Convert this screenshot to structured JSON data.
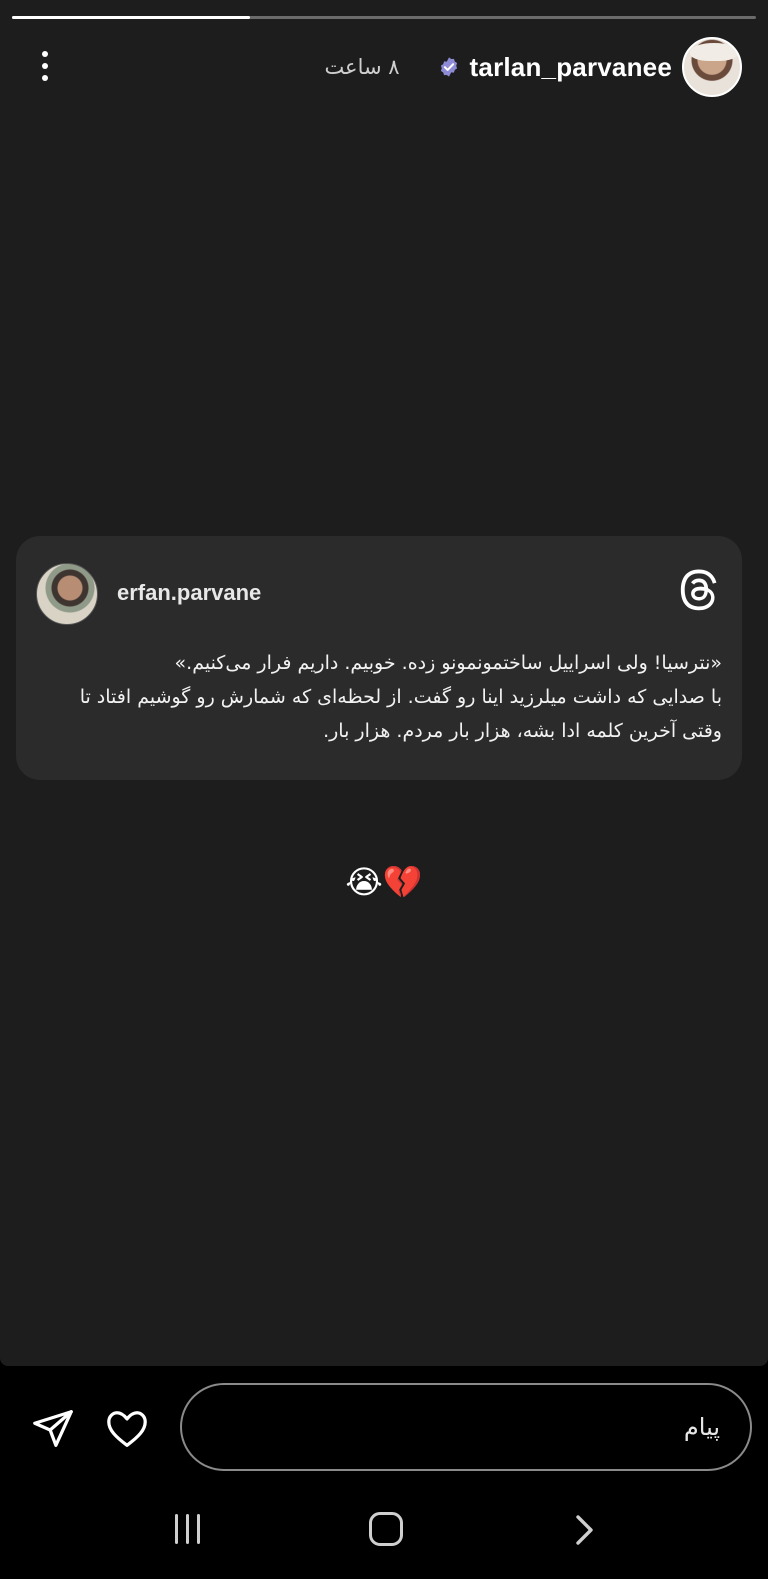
{
  "story": {
    "progress_fraction": 0.32,
    "header": {
      "username": "tarlan_parvanee",
      "time": "۸ ساعت"
    },
    "card": {
      "username": "erfan.parvane",
      "lines": [
        "«نترسیا! ولی اسراییل ساختمونمونو زده. خوبیم. داریم فرار می‌کنیم.»",
        "با صدایی که داشت میلرزید اینا رو گفت. از لحظه‌ای که شمارش رو گوشیم افتاد تا",
        "وقتی آخرین کلمه ادا بشه، هزار بار مردم. هزار بار."
      ]
    },
    "emoji": "😭💔"
  },
  "reply": {
    "placeholder": "پیام"
  },
  "icons": {
    "menu": "more-vertical-icon",
    "verified": "verified-badge-icon",
    "threads": "threads-logo-icon",
    "send": "send-icon",
    "heart": "heart-icon",
    "nav_recent": "recent-apps-icon",
    "nav_home": "home-icon",
    "nav_back": "back-icon"
  },
  "colors": {
    "story_background": "#1d1d1d",
    "card_background": "#2b2b2b",
    "verified_badge": "#8e8bd6",
    "bar_background": "#000000"
  }
}
